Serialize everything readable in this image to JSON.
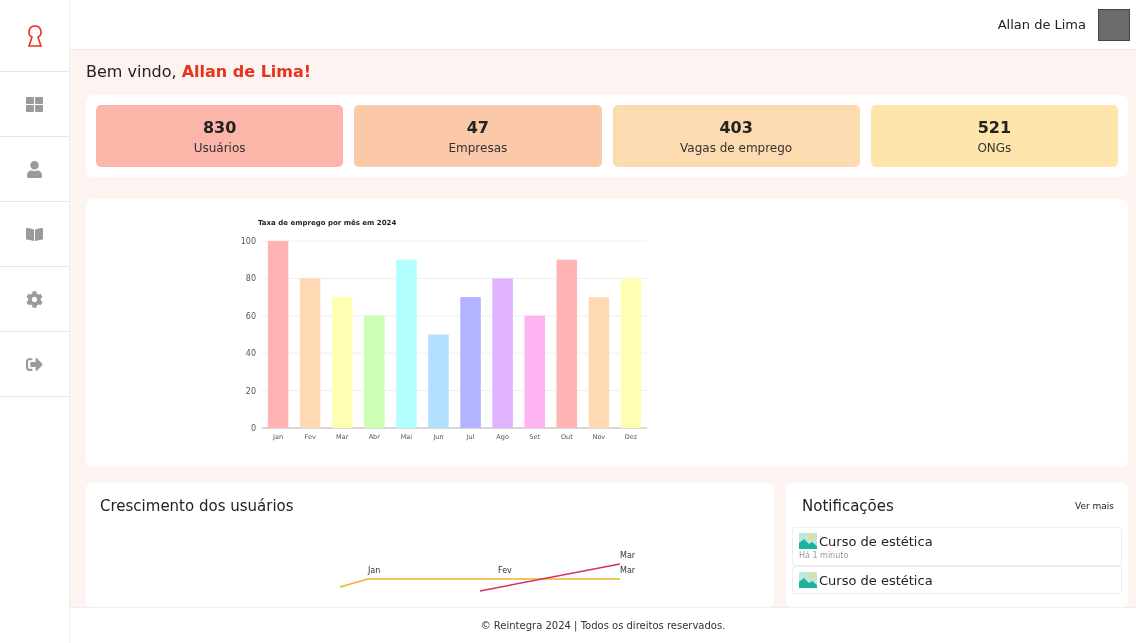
{
  "header": {
    "user_name": "Allan de Lima"
  },
  "welcome": {
    "greeting": "Bem vindo, ",
    "name": "Allan de Lima!"
  },
  "stats": [
    {
      "value": "830",
      "label": "Usuários",
      "color": "#fbb5a9"
    },
    {
      "value": "47",
      "label": "Empresas",
      "color": "#fcc8aa"
    },
    {
      "value": "403",
      "label": "Vagas de emprego",
      "color": "#fddbb0"
    },
    {
      "value": "521",
      "label": "ONGs",
      "color": "#fde5ac"
    }
  ],
  "employment_chart": {
    "chart_data": {
      "type": "bar",
      "title": "Taxa de emprego por mês em 2024",
      "categories": [
        "Jan",
        "Fev",
        "Mar",
        "Abr",
        "Mai",
        "Jun",
        "Jul",
        "Ago",
        "Set",
        "Out",
        "Nov",
        "Dez"
      ],
      "values": [
        100,
        80,
        70,
        60,
        90,
        50,
        70,
        80,
        60,
        90,
        70,
        80
      ],
      "colors": [
        "#ffb3b3",
        "#ffd9b3",
        "#ffffb3",
        "#ccffb3",
        "#b3ffff",
        "#b3e0ff",
        "#b3b3ff",
        "#e0b3ff",
        "#ffb3f0",
        "#ffb3b3",
        "#ffd9b3",
        "#ffffb3"
      ],
      "ylim": [
        0,
        100
      ],
      "yticks": [
        0,
        20,
        40,
        60,
        80,
        100
      ],
      "grid": true
    }
  },
  "growth": {
    "title": "Crescimento dos usuários",
    "point_labels": [
      "Jan",
      "Fev",
      "Mar",
      "Mar"
    ]
  },
  "notifications": {
    "title": "Notificações",
    "more_link": "Ver mais",
    "items": [
      {
        "title": "Curso de estética",
        "time": "Há 1 minuto"
      },
      {
        "title": "Curso de estética"
      }
    ]
  },
  "footer": {
    "text": "© Reintegra 2024 | Todos os direitos reservados."
  }
}
